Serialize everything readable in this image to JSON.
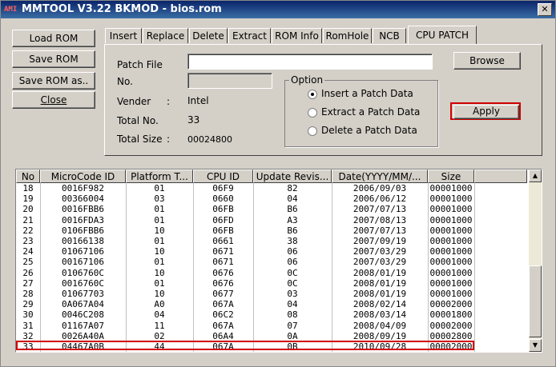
{
  "window": {
    "title": "MMTOOL V3.22 BKMOD - bios.rom",
    "icon_label": "AMI",
    "close_label": "✕"
  },
  "left_buttons": {
    "load": "Load ROM",
    "save": "Save ROM",
    "save_as": "Save ROM as..",
    "close": "Close"
  },
  "tabs": [
    {
      "label": "Insert"
    },
    {
      "label": "Replace"
    },
    {
      "label": "Delete"
    },
    {
      "label": "Extract"
    },
    {
      "label": "ROM Info"
    },
    {
      "label": "RomHole"
    },
    {
      "label": "NCB"
    },
    {
      "label": "CPU PATCH",
      "active": true
    }
  ],
  "panel": {
    "patch_file_label": "Patch File",
    "patch_file_value": "",
    "no_label": "No.",
    "no_value": "",
    "browse_label": "Browse",
    "vendor_label": "Vender",
    "vendor_sep": ":",
    "vendor_value": "Intel",
    "total_no_label": "Total No.",
    "total_no_value": "33",
    "total_size_label": "Total Size",
    "total_size_sep": ":",
    "total_size_value": "00024800",
    "option_title": "Option",
    "options": [
      {
        "label": "Insert a Patch Data",
        "selected": true
      },
      {
        "label": "Extract a Patch Data",
        "selected": false
      },
      {
        "label": "Delete a Patch Data",
        "selected": false
      }
    ],
    "apply_label": "Apply"
  },
  "table": {
    "columns": [
      "No",
      "MicroCode ID",
      "Platform T...",
      "CPU ID",
      "Update Revis...",
      "Date(YYYY/MM/...",
      "Size"
    ],
    "rows": [
      [
        "18",
        "0016F982",
        "01",
        "06F9",
        "82",
        "2006/09/03",
        "00001000"
      ],
      [
        "19",
        "00366004",
        "03",
        "0660",
        "04",
        "2006/06/12",
        "00001000"
      ],
      [
        "20",
        "0016FBB6",
        "01",
        "06FB",
        "B6",
        "2007/07/13",
        "00001000"
      ],
      [
        "21",
        "0016FDA3",
        "01",
        "06FD",
        "A3",
        "2007/08/13",
        "00001000"
      ],
      [
        "22",
        "0106FBB6",
        "10",
        "06FB",
        "B6",
        "2007/07/13",
        "00001000"
      ],
      [
        "23",
        "00166138",
        "01",
        "0661",
        "38",
        "2007/09/19",
        "00001000"
      ],
      [
        "24",
        "01067106",
        "10",
        "0671",
        "06",
        "2007/03/29",
        "00001000"
      ],
      [
        "25",
        "00167106",
        "01",
        "0671",
        "06",
        "2007/03/29",
        "00001000"
      ],
      [
        "26",
        "0106760C",
        "10",
        "0676",
        "0C",
        "2008/01/19",
        "00001000"
      ],
      [
        "27",
        "0016760C",
        "01",
        "0676",
        "0C",
        "2008/01/19",
        "00001000"
      ],
      [
        "28",
        "01067703",
        "10",
        "0677",
        "03",
        "2008/01/19",
        "00001000"
      ],
      [
        "29",
        "0A067A04",
        "A0",
        "067A",
        "04",
        "2008/02/14",
        "00002000"
      ],
      [
        "30",
        "0046C208",
        "04",
        "06C2",
        "08",
        "2008/03/14",
        "00001800"
      ],
      [
        "31",
        "01167A07",
        "11",
        "067A",
        "07",
        "2008/04/09",
        "00002000"
      ],
      [
        "32",
        "0026A40A",
        "02",
        "06A4",
        "0A",
        "2008/09/19",
        "00002800"
      ],
      [
        "33",
        "04467A0B",
        "44",
        "067A",
        "0B",
        "2010/09/28",
        "00002000"
      ]
    ]
  },
  "colors": {
    "highlight": "#d00000",
    "title_bar": "#0a246a"
  }
}
